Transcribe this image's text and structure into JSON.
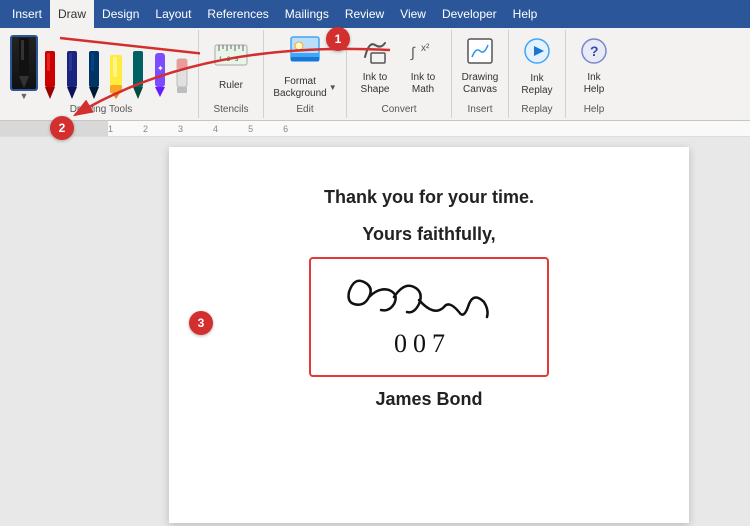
{
  "menubar": {
    "items": [
      {
        "label": "Insert",
        "active": false
      },
      {
        "label": "Draw",
        "active": true
      },
      {
        "label": "Design",
        "active": false
      },
      {
        "label": "Layout",
        "active": false
      },
      {
        "label": "References",
        "active": false
      },
      {
        "label": "Mailings",
        "active": false
      },
      {
        "label": "Review",
        "active": false
      },
      {
        "label": "View",
        "active": false
      },
      {
        "label": "Developer",
        "active": false
      },
      {
        "label": "Help",
        "active": false
      }
    ]
  },
  "toolbar": {
    "sections": {
      "drawing_tools_label": "Drawing Tools",
      "stencils_label": "Stencils",
      "edit_label": "Edit",
      "convert_label": "Convert",
      "insert_label": "Insert",
      "replay_label": "Replay",
      "help_label": "Help"
    },
    "buttons": {
      "ruler": "Ruler",
      "format_background": "Format Background",
      "ink_to_shape": "Ink to Shape",
      "ink_to_math": "Ink to Math",
      "drawing_canvas": "Drawing Canvas",
      "ink_replay": "Ink Replay",
      "ink_help": "Ink Help"
    }
  },
  "annotations": [
    {
      "id": 1,
      "label": "1"
    },
    {
      "id": 2,
      "label": "2"
    },
    {
      "id": 3,
      "label": "3"
    }
  ],
  "document": {
    "thank_you": "Thank you for your time.",
    "closing": "Yours faithfully,",
    "signature_text": "Bond\n007",
    "name": "James Bond"
  },
  "ruler": {
    "ticks": [
      "1",
      "2",
      "3",
      "4",
      "5",
      "6"
    ]
  }
}
